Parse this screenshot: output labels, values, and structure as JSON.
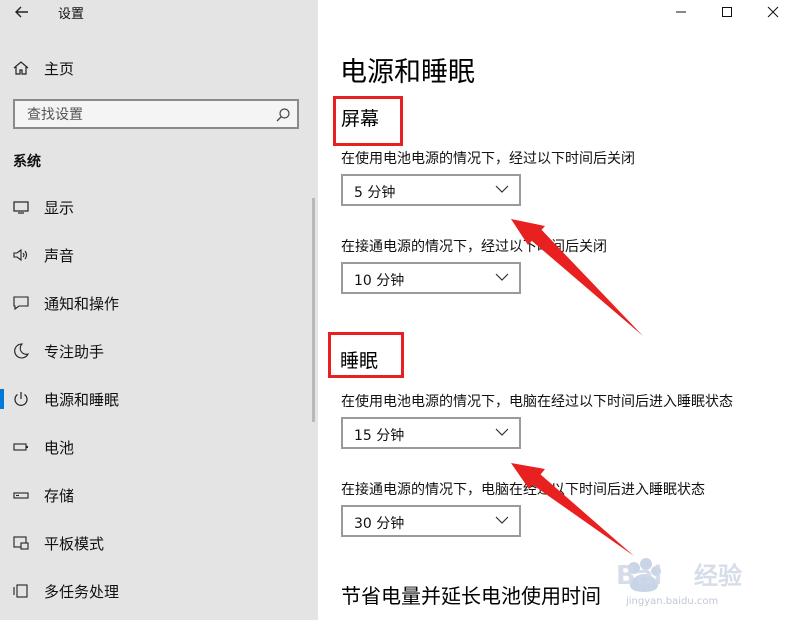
{
  "window": {
    "title": "设置",
    "controls": [
      "minimize-icon",
      "maximize-icon",
      "close-icon"
    ]
  },
  "sidebar": {
    "home_label": "主页",
    "search_placeholder": "查找设置",
    "section_title": "系统",
    "items": [
      {
        "label": "显示",
        "icon": "display-icon"
      },
      {
        "label": "声音",
        "icon": "speaker-icon"
      },
      {
        "label": "通知和操作",
        "icon": "notification-icon"
      },
      {
        "label": "专注助手",
        "icon": "moon-icon"
      },
      {
        "label": "电源和睡眠",
        "icon": "power-icon",
        "active": true
      },
      {
        "label": "电池",
        "icon": "battery-icon"
      },
      {
        "label": "存储",
        "icon": "storage-icon"
      },
      {
        "label": "平板模式",
        "icon": "tablet-mode-icon"
      },
      {
        "label": "多任务处理",
        "icon": "multitasking-icon"
      }
    ]
  },
  "main": {
    "page_title": "电源和睡眠",
    "screen": {
      "heading": "屏幕",
      "battery_label": "在使用电池电源的情况下，经过以下时间后关闭",
      "battery_value": "5 分钟",
      "plugged_label": "在接通电源的情况下，经过以下时间后关闭",
      "plugged_value": "10 分钟"
    },
    "sleep": {
      "heading": "睡眠",
      "battery_label": "在使用电池电源的情况下，电脑在经过以下时间后进入睡眠状态",
      "battery_value": "15 分钟",
      "plugged_label": "在接通电源的情况下，电脑在经过以下时间后进入睡眠状态",
      "plugged_value": "30 分钟"
    },
    "battery_section_title": "节省电量并延长电池使用时间"
  },
  "annotation": {
    "highlight_color": "#e8201f"
  },
  "watermark": {
    "brand": "Baidu经验",
    "url": "jingyan.baidu.com"
  },
  "colors": {
    "sidebar_bg": "#e4e4e4",
    "accent": "#0078d7"
  }
}
